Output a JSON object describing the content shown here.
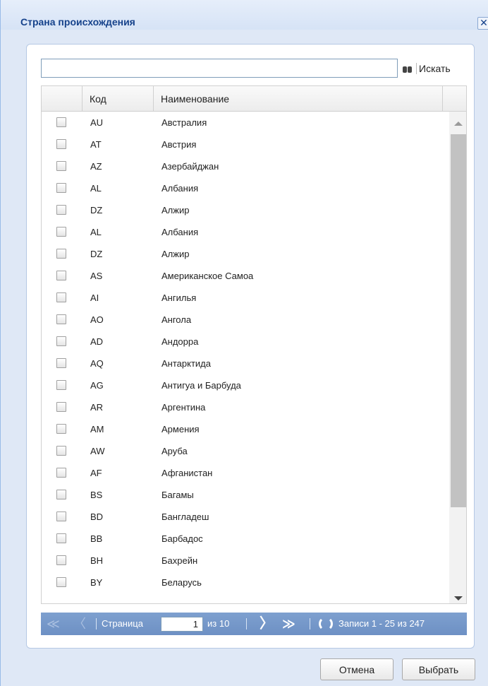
{
  "window": {
    "title": "Страна происхождения",
    "close_glyph": "✕"
  },
  "search": {
    "value": "",
    "placeholder": "",
    "button_label": "Искать"
  },
  "grid": {
    "columns": {
      "code": "Код",
      "name": "Наименование"
    },
    "rows": [
      {
        "code": "AU",
        "name": "Австралия"
      },
      {
        "code": "AT",
        "name": "Австрия"
      },
      {
        "code": "AZ",
        "name": "Азербайджан"
      },
      {
        "code": "AL",
        "name": "Албания"
      },
      {
        "code": "DZ",
        "name": "Алжир"
      },
      {
        "code": "AL",
        "name": "Албания"
      },
      {
        "code": "DZ",
        "name": "Алжир"
      },
      {
        "code": "AS",
        "name": "Американское Самоа"
      },
      {
        "code": "AI",
        "name": "Ангилья"
      },
      {
        "code": "AO",
        "name": "Ангола"
      },
      {
        "code": "AD",
        "name": "Андорра"
      },
      {
        "code": "AQ",
        "name": "Антарктида"
      },
      {
        "code": "AG",
        "name": "Антигуа и Барбуда"
      },
      {
        "code": "AR",
        "name": "Аргентина"
      },
      {
        "code": "AM",
        "name": "Армения"
      },
      {
        "code": "AW",
        "name": "Аруба"
      },
      {
        "code": "AF",
        "name": "Афганистан"
      },
      {
        "code": "BS",
        "name": "Багамы"
      },
      {
        "code": "BD",
        "name": "Бангладеш"
      },
      {
        "code": "BB",
        "name": "Барбадос"
      },
      {
        "code": "BH",
        "name": "Бахрейн"
      },
      {
        "code": "BY",
        "name": "Беларусь"
      }
    ]
  },
  "pager": {
    "first_glyph": "≪",
    "prev_glyph": "〈",
    "next_glyph": "〉",
    "last_glyph": "≫",
    "page_label": "Страница",
    "page_value": "1",
    "of_label": "из 10",
    "records_label": "Записи 1 - 25 из 247"
  },
  "footer": {
    "cancel_label": "Отмена",
    "select_label": "Выбрать"
  }
}
